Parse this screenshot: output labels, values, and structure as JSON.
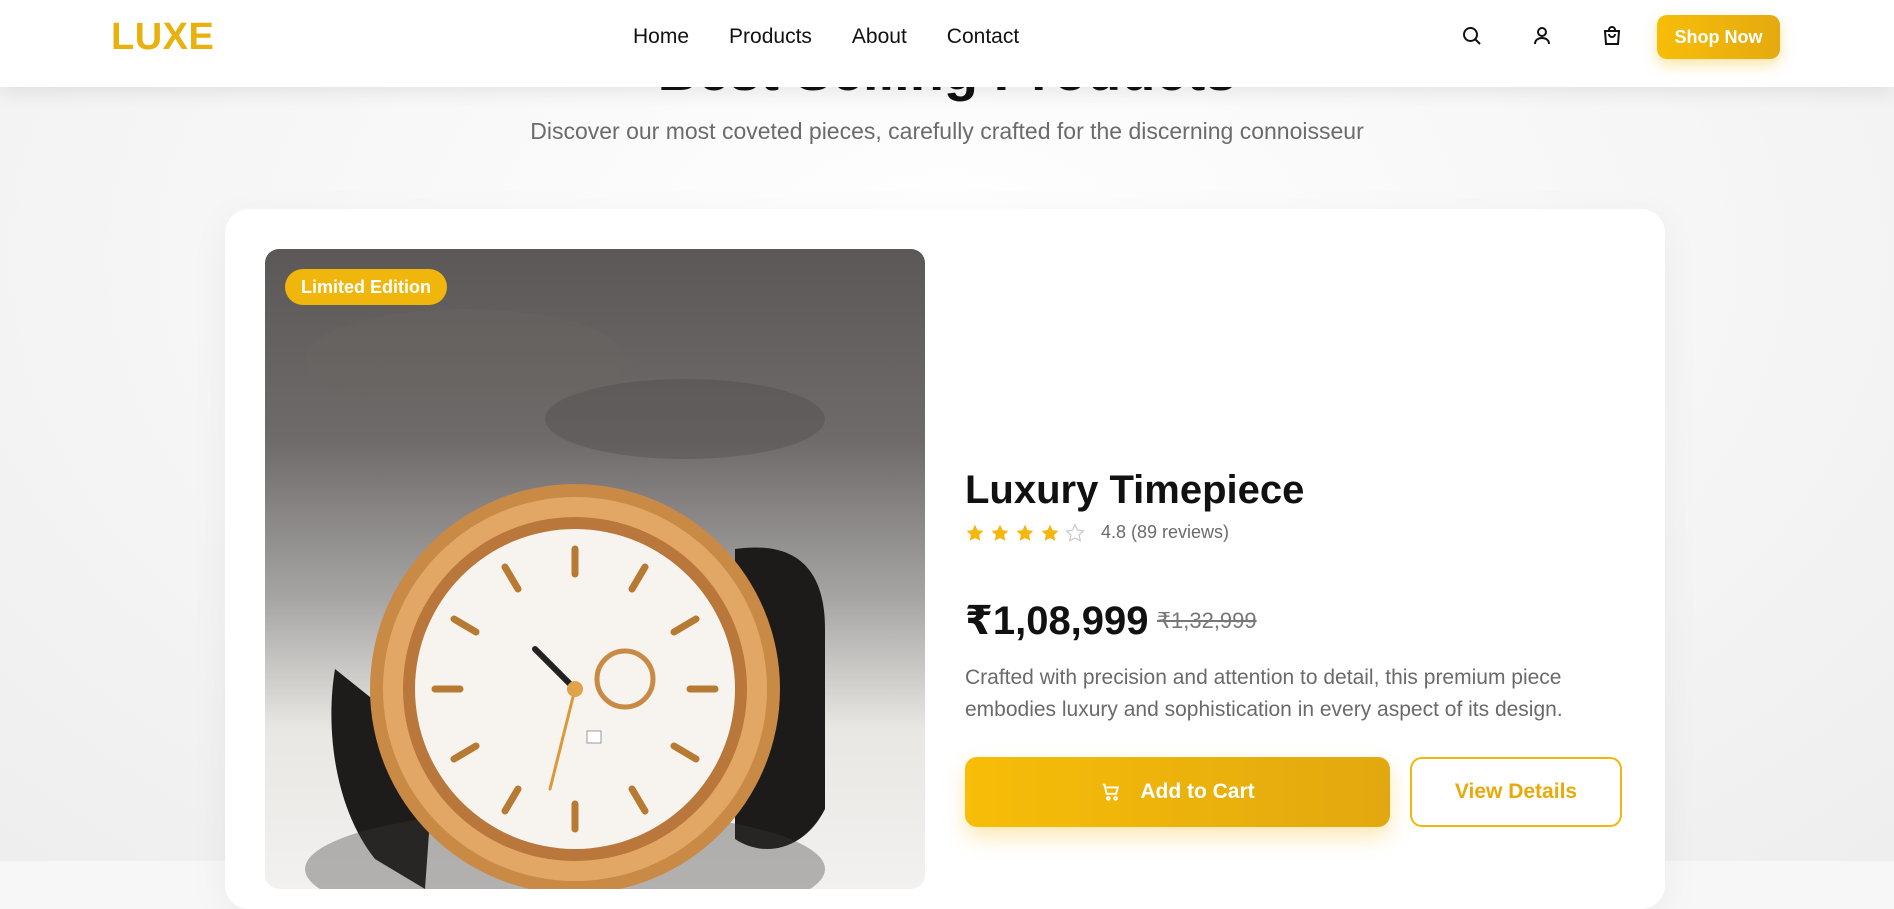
{
  "header": {
    "logo": "LUXE",
    "nav": [
      "Home",
      "Products",
      "About",
      "Contact"
    ],
    "icons": [
      "search-icon",
      "user-icon",
      "shopping-bag-icon"
    ],
    "cta": "Shop Now"
  },
  "section": {
    "title": "Best Selling Products",
    "subtitle": "Discover our most coveted pieces, carefully crafted for the discerning connoisseur"
  },
  "product": {
    "badge": "Limited Edition",
    "title": "Luxury Timepiece",
    "rating": 4.8,
    "rating_stars_filled": 4,
    "rating_stars_total": 5,
    "rating_text": "4.8 (89 reviews)",
    "price": "₹1,08,999",
    "old_price": "₹1,32,999",
    "description": "Crafted with precision and attention to detail, this premium piece embodies luxury and sophistication in every aspect of its design.",
    "add_to_cart": "Add to Cart",
    "view_details": "View Details"
  },
  "colors": {
    "accent": "#f1b60c",
    "text": "#111111",
    "muted": "#6b6b6b"
  }
}
